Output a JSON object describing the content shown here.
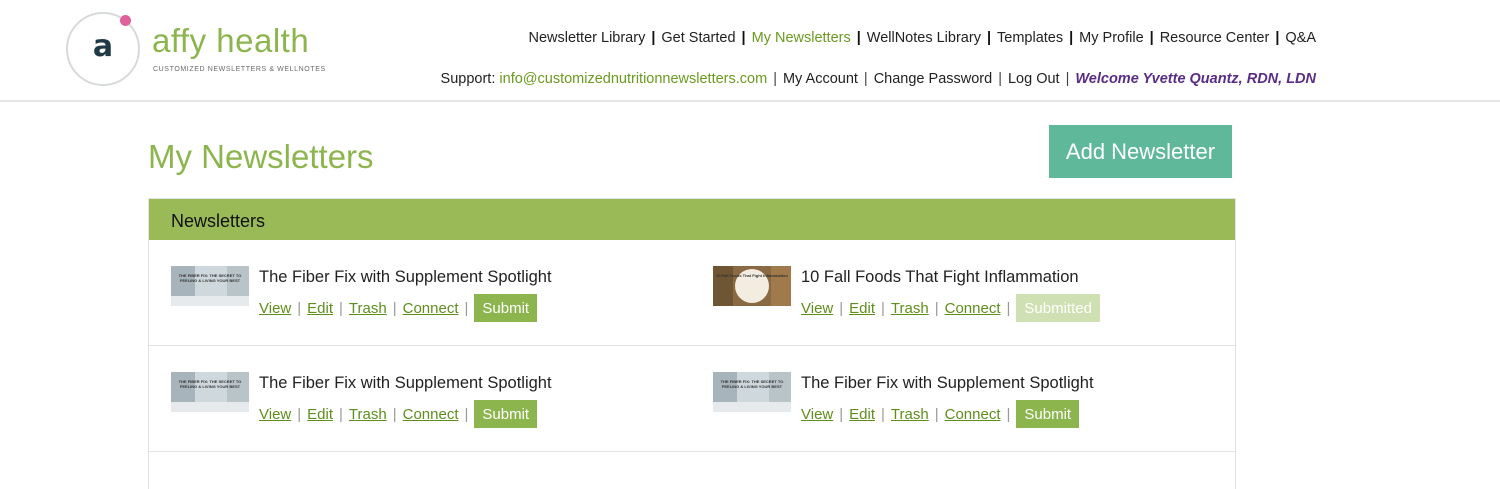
{
  "logo": {
    "letter": "a",
    "name": "affy health",
    "tagline": "CUSTOMIZED NEWSLETTERS & WELLNOTES"
  },
  "topnav": [
    "Newsletter Library",
    "Get Started",
    "My Newsletters",
    "WellNotes Library",
    "Templates",
    "My Profile",
    "Resource Center",
    "Q&A"
  ],
  "subnav": {
    "support_label": "Support:",
    "email": "info@customizednutritionnewsletters.com",
    "my_account": "My Account",
    "change_password": "Change Password",
    "log_out": "Log Out",
    "welcome": "Welcome Yvette Quantz, RDN, LDN"
  },
  "page": {
    "title": "My Newsletters",
    "add_button": "Add Newsletter"
  },
  "panel": {
    "header": "Newsletters"
  },
  "actions": {
    "view": "View",
    "edit": "Edit",
    "trash": "Trash",
    "connect": "Connect"
  },
  "newsletters": [
    {
      "title": "The Fiber Fix with Supplement Spotlight",
      "thumb_text": "THE FIBER FIX: THE SECRET TO FEELING & LIVING YOUR BEST",
      "status": "Submit"
    },
    {
      "title": "10 Fall Foods That Fight Inflammation",
      "thumb_text": "10 Fall Foods That Fight Inflammation",
      "status": "Submitted"
    },
    {
      "title": "The Fiber Fix with Supplement Spotlight",
      "thumb_text": "THE FIBER FIX: THE SECRET TO FEELING & LIVING YOUR BEST",
      "status": "Submit"
    },
    {
      "title": "The Fiber Fix with Supplement Spotlight",
      "thumb_text": "THE FIBER FIX: THE SECRET TO FEELING & LIVING YOUR BEST",
      "status": "Submit"
    }
  ],
  "colors": {
    "brand_green": "#8db54e",
    "add_button": "#5fb89a",
    "panel_header": "#9aba58",
    "welcome": "#5b2c86"
  }
}
